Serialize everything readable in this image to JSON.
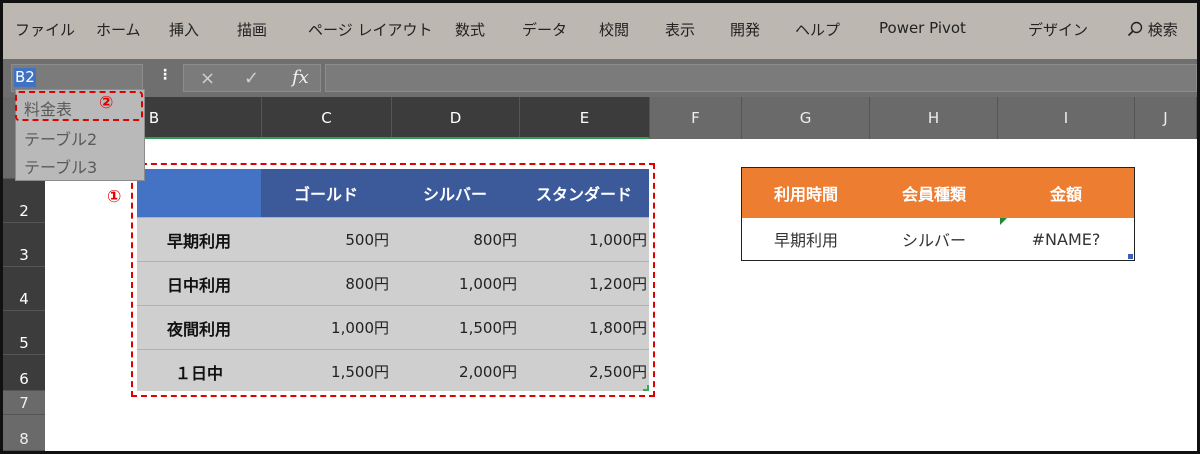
{
  "ribbon": {
    "tabs": [
      "ファイル",
      "ホーム",
      "挿入",
      "描画",
      "ページ レイアウト",
      "数式",
      "データ",
      "校閲",
      "表示",
      "開発",
      "ヘルプ",
      "Power Pivot",
      "デザイン"
    ],
    "search_label": "検索",
    "search_icon": "search-icon"
  },
  "formula_bar": {
    "name_box": "B2",
    "cancel_icon": "×",
    "enter_icon": "✓",
    "fx_label": "fx",
    "content": ""
  },
  "name_box_dropdown": {
    "items": [
      "料金表",
      "テーブル2",
      "テーブル3"
    ],
    "annotation": "②"
  },
  "grid": {
    "columns": [
      "B",
      "C",
      "D",
      "E",
      "F",
      "G",
      "H",
      "I",
      "J"
    ],
    "rows": [
      "2",
      "3",
      "4",
      "5",
      "6",
      "7",
      "8"
    ],
    "selected_columns": [
      "B",
      "C",
      "D",
      "E"
    ]
  },
  "price_table": {
    "annotation": "①",
    "headers": [
      "",
      "ゴールド",
      "シルバー",
      "スタンダード"
    ],
    "rows": [
      {
        "label": "早期利用",
        "values": [
          "500円",
          "800円",
          "1,000円"
        ]
      },
      {
        "label": "日中利用",
        "values": [
          "800円",
          "1,000円",
          "1,200円"
        ]
      },
      {
        "label": "夜間利用",
        "values": [
          "1,000円",
          "1,500円",
          "1,800円"
        ]
      },
      {
        "label": "１日中",
        "values": [
          "1,500円",
          "2,000円",
          "2,500円"
        ]
      }
    ]
  },
  "lookup_table": {
    "headers": [
      "利用時間",
      "会員種類",
      "金額"
    ],
    "values": [
      "早期利用",
      "シルバー",
      "#NAME?"
    ]
  },
  "colors": {
    "ribbon_bg": "#bdb7b1",
    "table_header": "#3c5a9a",
    "table_corner": "#4472c4",
    "lookup_header": "#ed7d31",
    "annotation_red": "#e00000"
  }
}
